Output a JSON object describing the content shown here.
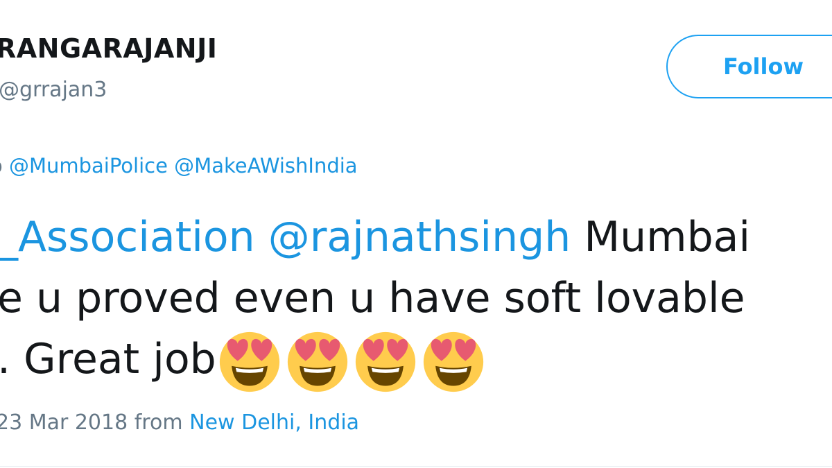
{
  "header": {
    "display_name": "RANGARAJANJI",
    "handle": "@grrajan3",
    "follow_label": "Follow"
  },
  "reply": {
    "prefix": "o",
    "mentions": [
      "@MumbaiPolice",
      "@MakeAWishIndia"
    ]
  },
  "tweet": {
    "line1": {
      "mention1": "_Association",
      "mention2": "@rajnathsingh",
      "text": "Mumbai"
    },
    "line2": "e u proved even u have soft lovable",
    "line3": ". Great job",
    "emojis": [
      "heart-eyes-emoji",
      "heart-eyes-emoji",
      "heart-eyes-emoji",
      "heart-eyes-emoji"
    ]
  },
  "meta": {
    "date": "23 Mar 2018",
    "from_label": "from",
    "location": "New Delhi, India"
  },
  "colors": {
    "link": "#1b95e0",
    "follow": "#1da1f2",
    "muted": "#657786",
    "text": "#14171a",
    "emoji_face": "#ffcc4d",
    "emoji_heart": "#e75a70",
    "emoji_mouth": "#664500"
  }
}
